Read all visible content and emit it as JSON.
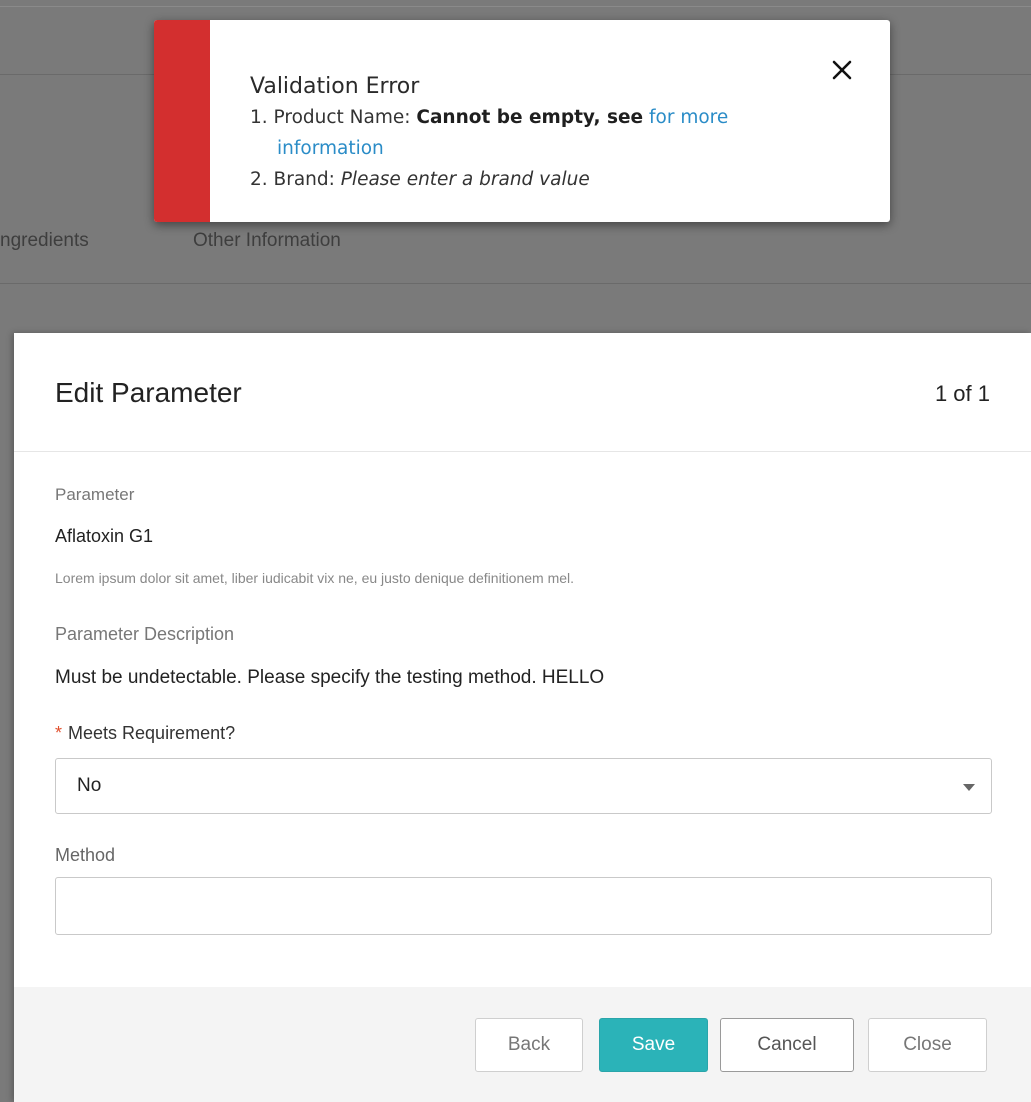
{
  "background": {
    "tabs": [
      "ngredients",
      "Other Information"
    ]
  },
  "toast": {
    "title": "Validation Error",
    "close_icon": "close-icon",
    "accent_color": "#d32f2f",
    "items": [
      {
        "number": "1.",
        "label": "Product Name:",
        "message_bold": "Cannot be empty, see",
        "link_line1": "for more",
        "link_line2": "information"
      },
      {
        "number": "2.",
        "label": "Brand:",
        "message": "Please enter a brand value"
      }
    ]
  },
  "modal": {
    "title": "Edit Parameter",
    "counter": "1 of 1",
    "parameter_label": "Parameter",
    "parameter_value": "Aflatoxin G1",
    "parameter_note": "Lorem ipsum dolor sit amet, liber iudicabit vix ne, eu justo denique definitionem mel.",
    "description_label": "Parameter Description",
    "description_value": "Must be undetectable. Please specify the testing method. HELLO",
    "meets_requirement": {
      "required_marker": "*",
      "label": "Meets Requirement?",
      "selected": "No",
      "caret_icon": "caret-down-icon"
    },
    "method": {
      "label": "Method",
      "value": ""
    },
    "buttons": {
      "back": "Back",
      "save": "Save",
      "cancel": "Cancel",
      "close": "Close"
    },
    "save_color": "#2bb3b8"
  }
}
